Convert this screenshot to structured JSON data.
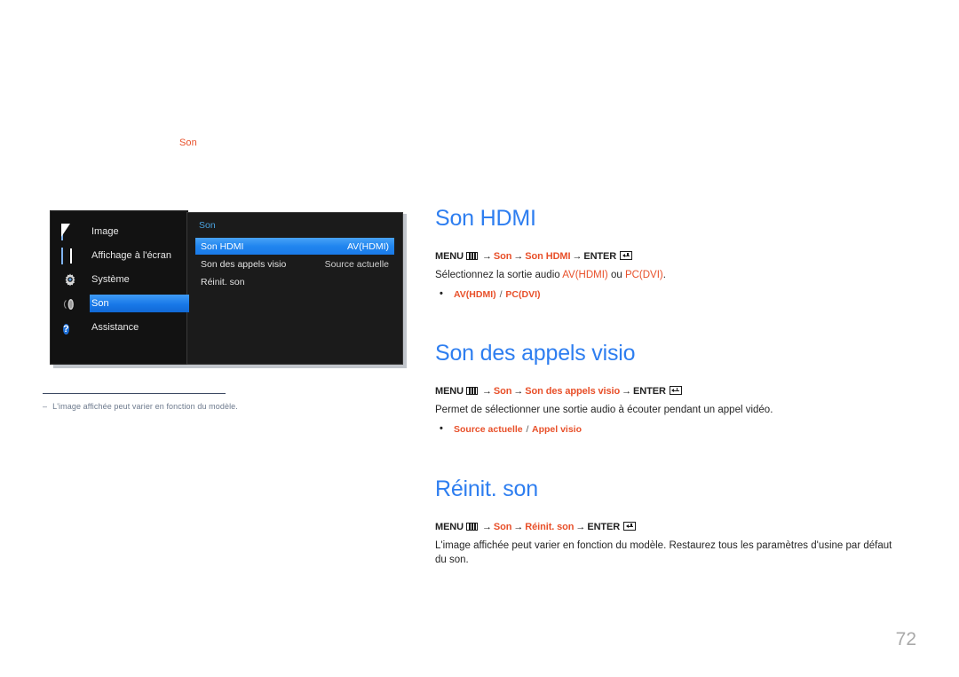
{
  "breadcrumb": {
    "label": "Son"
  },
  "osd": {
    "sidebar": {
      "items": [
        {
          "label": "Image",
          "icon": "picture-icon",
          "selected": false
        },
        {
          "label": "Affichage à l'écran",
          "icon": "osd-grid-icon",
          "selected": false
        },
        {
          "label": "Système",
          "icon": "gear-icon",
          "selected": false
        },
        {
          "label": "Son",
          "icon": "sound-icon",
          "selected": true
        },
        {
          "label": "Assistance",
          "icon": "help-circle-icon",
          "selected": false
        }
      ]
    },
    "panel": {
      "title": "Son",
      "items": [
        {
          "label": "Son HDMI",
          "value": "AV(HDMI)",
          "selected": true
        },
        {
          "label": "Son des appels visio",
          "value": "Source actuelle",
          "selected": false
        },
        {
          "label": "Réinit. son",
          "value": "",
          "selected": false
        }
      ]
    }
  },
  "footnote": {
    "dash": "‒",
    "text": "L'image affichée peut varier en fonction du modèle."
  },
  "sections": [
    {
      "heading": "Son HDMI",
      "path": {
        "menu_label": "MENU",
        "menu_icon": "menu-bars-icon",
        "crumb1": "Son",
        "crumb2": "Son HDMI",
        "enter_label": "ENTER",
        "enter_icon": "enter-key-icon",
        "arrow": "→"
      },
      "description_pre": "Sélectionnez la sortie audio ",
      "description_opt1": "AV(HDMI)",
      "description_mid": " ou ",
      "description_opt2": "PC(DVI)",
      "description_post": ".",
      "options": {
        "first": "AV(HDMI)",
        "sep": "/",
        "second": "PC(DVI)"
      }
    },
    {
      "heading": "Son des appels visio",
      "path": {
        "menu_label": "MENU",
        "menu_icon": "menu-bars-icon",
        "crumb1": "Son",
        "crumb2": "Son des appels visio",
        "enter_label": "ENTER",
        "enter_icon": "enter-key-icon",
        "arrow": "→"
      },
      "description": "Permet de sélectionner une sortie audio à écouter pendant un appel vidéo.",
      "options": {
        "first": "Source actuelle",
        "sep": "/",
        "second": "Appel visio"
      }
    },
    {
      "heading": "Réinit. son",
      "path": {
        "menu_label": "MENU",
        "menu_icon": "menu-bars-icon",
        "crumb1": "Son",
        "crumb2": "Réinit. son",
        "enter_label": "ENTER",
        "enter_icon": "enter-key-icon",
        "arrow": "→"
      },
      "description": "L'image affichée peut varier en fonction du modèle. Restaurez tous les paramètres d'usine par défaut du son."
    }
  ],
  "page_number": "72",
  "colors": {
    "heading_blue": "#2e7ef0",
    "accent_orange": "#e8502a",
    "osd_highlight": "#1d7ae8",
    "page_number_gray": "#a9a9a9",
    "footnote_gray": "#6d7a8d"
  }
}
